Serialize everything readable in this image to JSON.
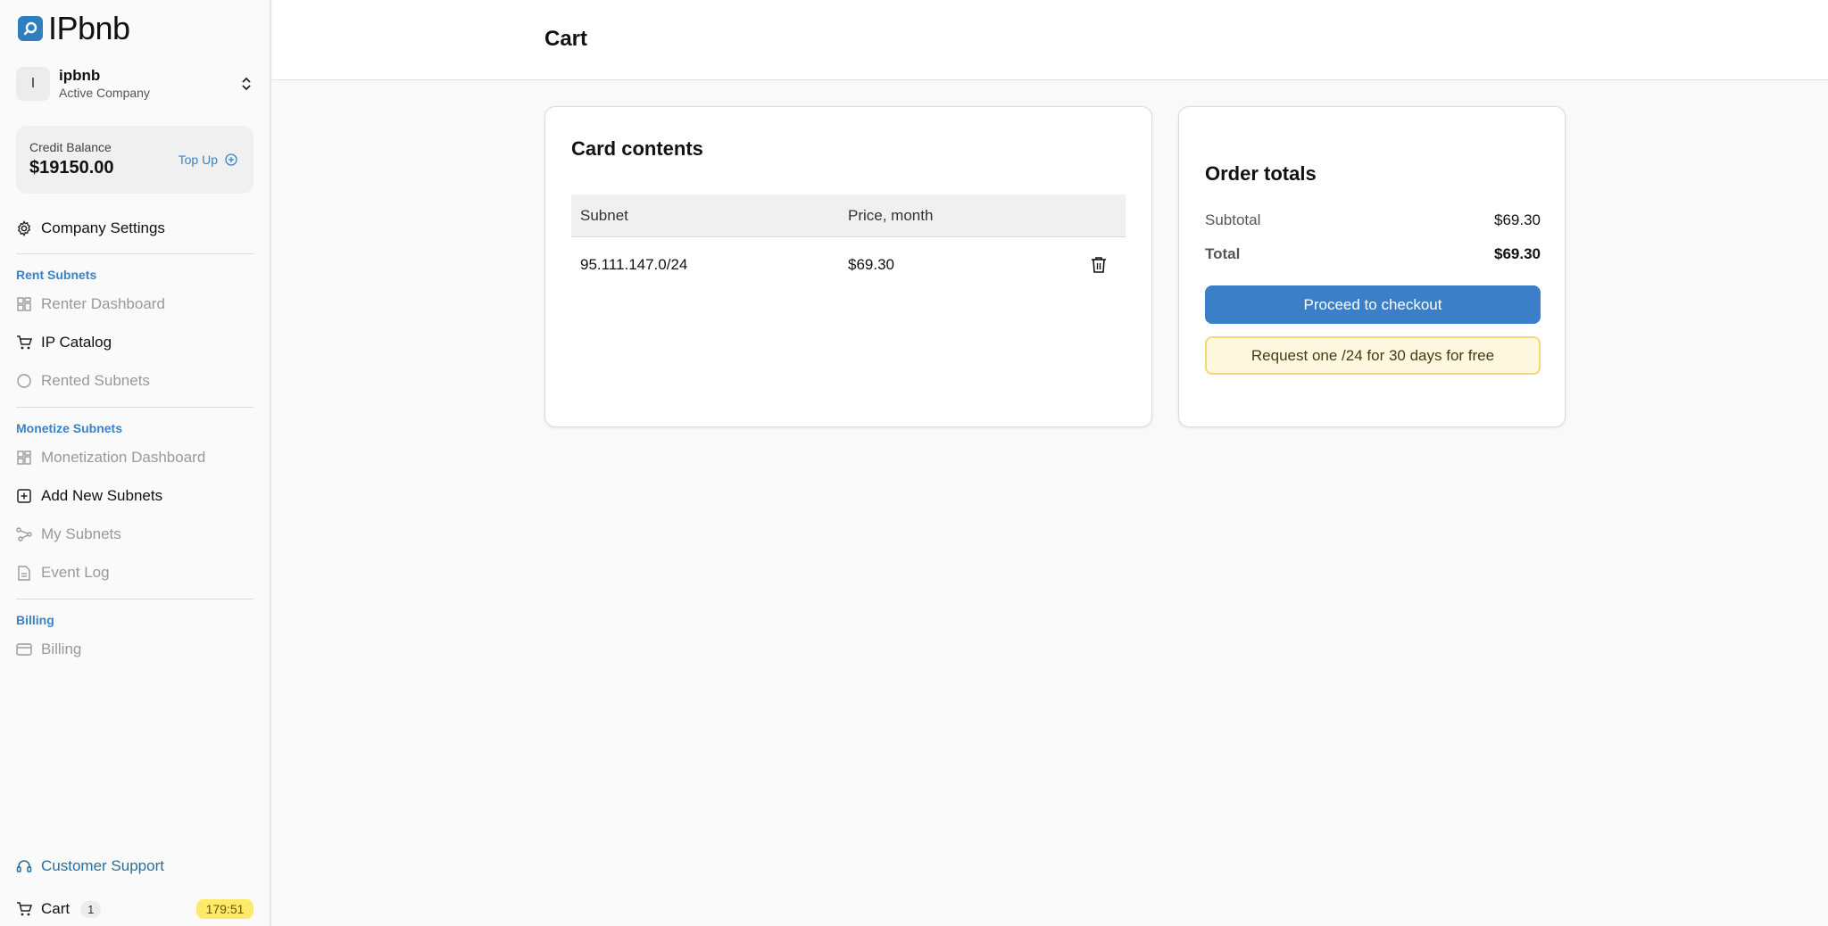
{
  "app": {
    "logo_text": "IPbnb"
  },
  "company": {
    "initial": "I",
    "name": "ipbnb",
    "subtitle": "Active Company"
  },
  "credit": {
    "label": "Credit Balance",
    "value": "$19150.00",
    "topup_label": "Top Up"
  },
  "sidebar": {
    "company_settings": "Company Settings",
    "sections": [
      {
        "label": "Rent Subnets",
        "items": [
          "Renter Dashboard",
          "IP Catalog",
          "Rented Subnets"
        ]
      },
      {
        "label": "Monetize Subnets",
        "items": [
          "Monetization Dashboard",
          "Add New Subnets",
          "My Subnets",
          "Event Log"
        ]
      },
      {
        "label": "Billing",
        "items": [
          "Billing"
        ]
      }
    ],
    "customer_support": "Customer Support",
    "cart_label": "Cart",
    "cart_count": "1",
    "timer": "179:51"
  },
  "header": {
    "title": "Cart"
  },
  "cart": {
    "title": "Card contents",
    "columns": [
      "Subnet",
      "Price, month"
    ],
    "rows": [
      {
        "subnet": "95.111.147.0/24",
        "price": "$69.30"
      }
    ]
  },
  "totals": {
    "title": "Order totals",
    "subtotal_label": "Subtotal",
    "subtotal_value": "$69.30",
    "total_label": "Total",
    "total_value": "$69.30",
    "checkout_label": "Proceed to checkout",
    "free_label": "Request one /24 for 30 days for free"
  },
  "colors": {
    "accent": "#3a7fc7",
    "section_label": "#3b82c4",
    "timer_bg": "#fde96a",
    "free_bg": "#fff8e1"
  }
}
